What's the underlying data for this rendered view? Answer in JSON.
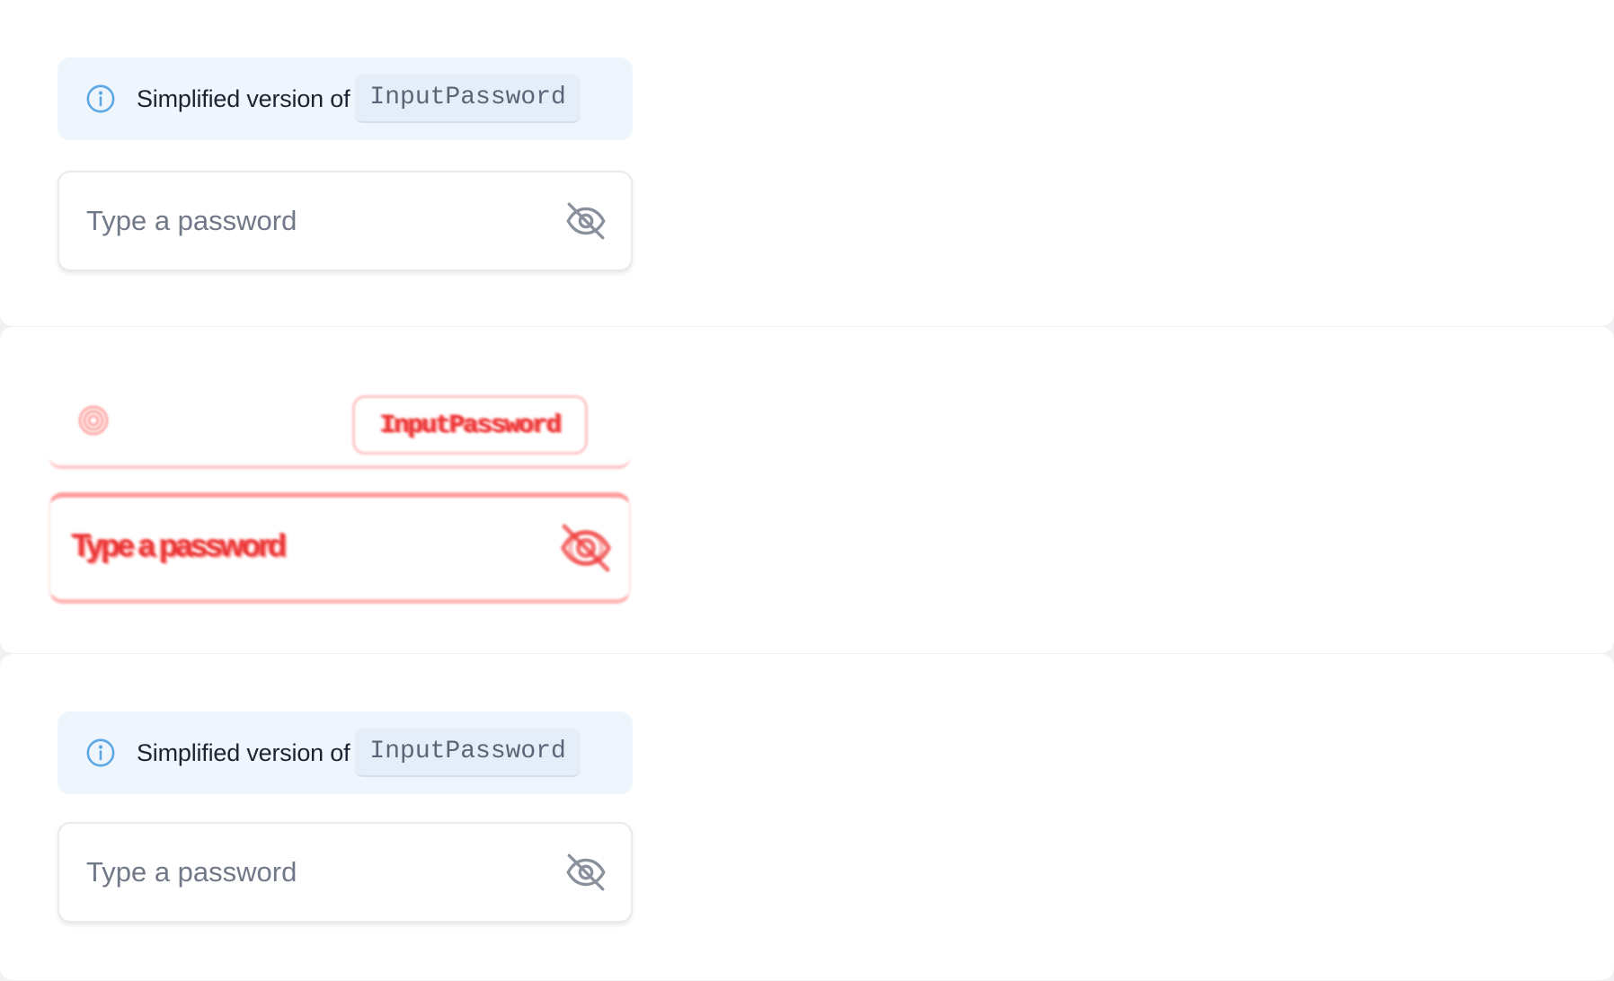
{
  "top": {
    "callout": {
      "text": "Simplified version of",
      "code": "InputPassword",
      "icon": "info-icon"
    },
    "password_field": {
      "placeholder": "Type a password",
      "value": "",
      "toggle_icon": "eye-off-icon"
    }
  },
  "diff": {
    "callout": {
      "code": "InputPassword",
      "icon": "info-icon"
    },
    "password_field": {
      "placeholder": "Type a password",
      "toggle_icon": "eye-off-icon"
    },
    "highlight_color": "#ff4d4d"
  },
  "bottom": {
    "callout": {
      "text": "Simplified version of",
      "code": "InputPassword",
      "icon": "info-icon"
    },
    "password_field": {
      "placeholder": "Type a password",
      "value": "",
      "toggle_icon": "eye-off-icon"
    }
  },
  "colors": {
    "callout_bg": "#eef5fd",
    "info_icon": "#5aa7e6",
    "text": "#1c2434",
    "placeholder": "#717887",
    "page_bg": "#f1f1f3"
  }
}
